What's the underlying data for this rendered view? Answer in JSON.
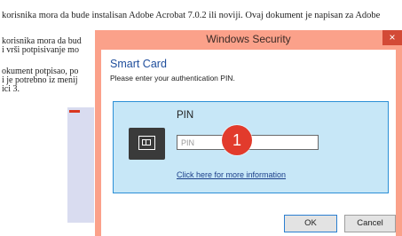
{
  "document": {
    "line_top": "korisnika mora da bude instalisan Adobe Acrobat 7.0.2 ili noviji. Ovaj dokument je napisan za Adobe",
    "line_1": "korisnika mora da bud",
    "line_2": "i vrši potpisivanje mo",
    "line_3": "okument potpisao, po",
    "line_4": "i je potrebno iz menij",
    "line_5": "ici 3."
  },
  "dialog": {
    "title": "Windows Security",
    "close_label": "×",
    "heading": "Smart Card",
    "subtext": "Please enter your authentication PIN.",
    "pin_label": "PIN",
    "pin_placeholder": "PIN",
    "pin_value": "",
    "step_number": "1",
    "more_info_link": "Click here for more information",
    "ok_label": "OK",
    "cancel_label": "Cancel"
  },
  "colors": {
    "window_frame": "#fba18a",
    "close_button": "#d34a36",
    "heading": "#1f4e9c",
    "panel_bg": "#c7e7f7",
    "panel_border": "#2b8fd6",
    "step_badge": "#e23b2c"
  },
  "icons": {
    "card_icon": "smart-card-icon",
    "close_icon": "close-icon"
  }
}
